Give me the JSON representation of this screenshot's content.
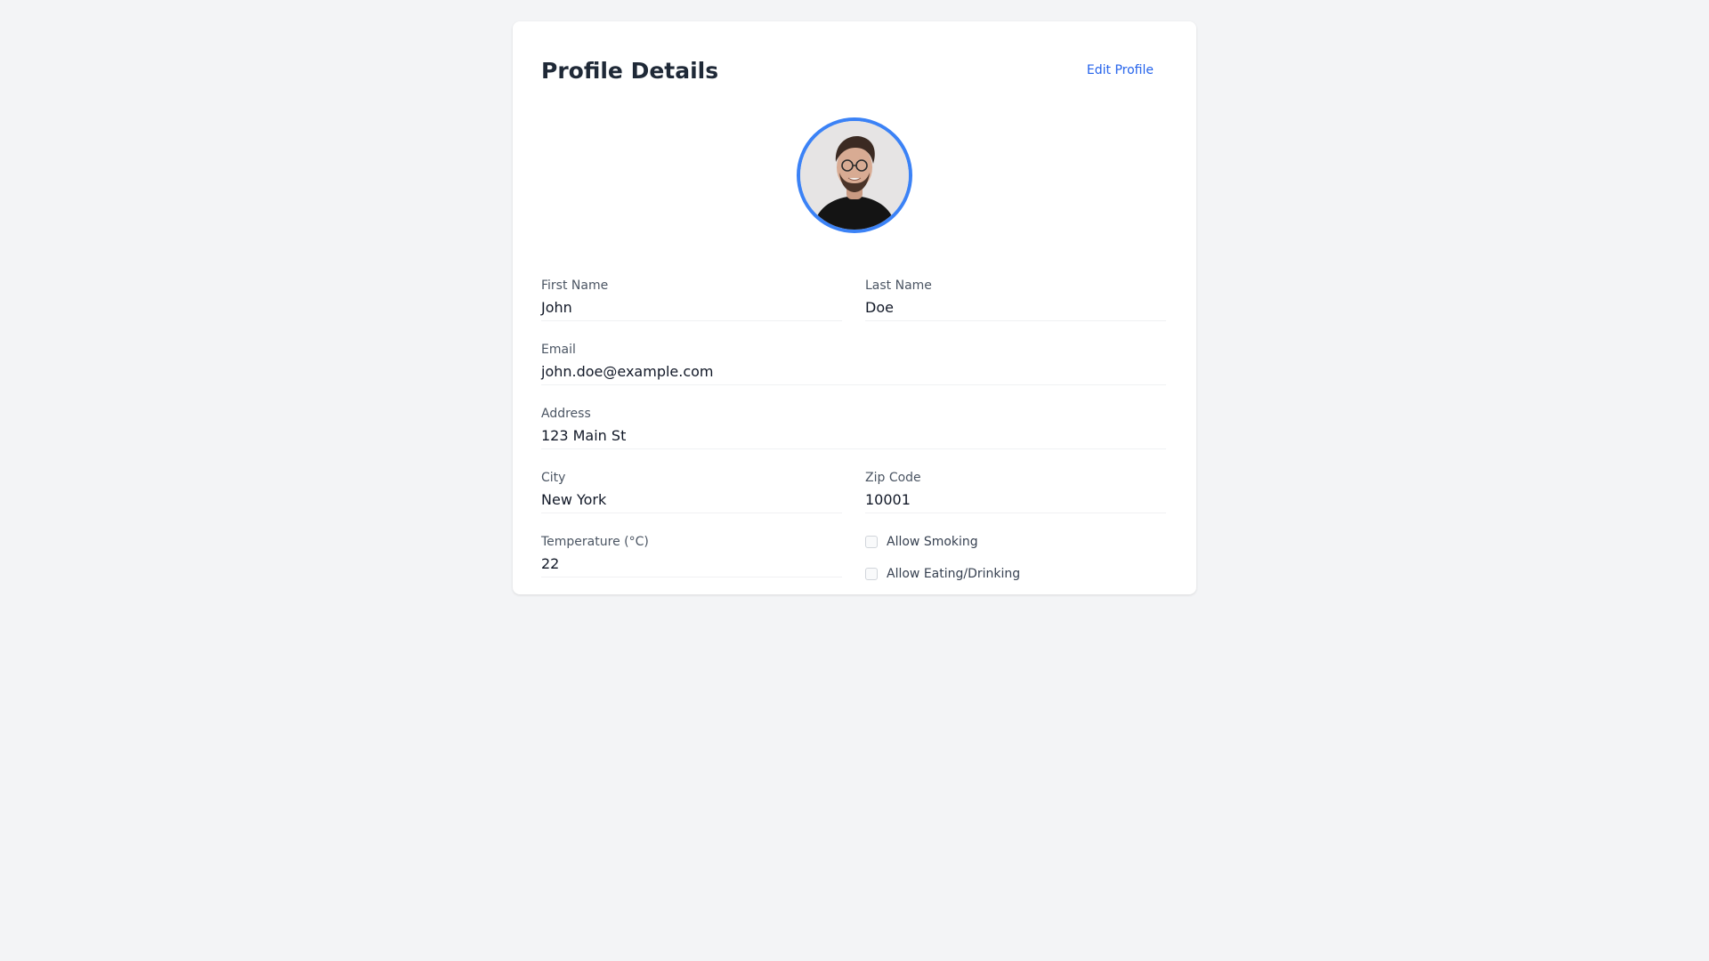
{
  "header": {
    "title": "Profile Details",
    "edit_label": "Edit Profile"
  },
  "avatar": {
    "border_color": "#3b82f6"
  },
  "fields": {
    "first_name": {
      "label": "First Name",
      "value": "John"
    },
    "last_name": {
      "label": "Last Name",
      "value": "Doe"
    },
    "email": {
      "label": "Email",
      "value": "john.doe@example.com"
    },
    "address": {
      "label": "Address",
      "value": "123 Main St"
    },
    "city": {
      "label": "City",
      "value": "New York"
    },
    "zip": {
      "label": "Zip Code",
      "value": "10001"
    },
    "temperature": {
      "label": "Temperature (°C)",
      "value": "22"
    }
  },
  "options": {
    "allow_smoking": {
      "label": "Allow Smoking",
      "checked": false
    },
    "allow_eating": {
      "label": "Allow Eating/Drinking",
      "checked": false
    }
  },
  "colors": {
    "accent": "#2563eb",
    "background": "#f3f4f6",
    "card": "#ffffff"
  }
}
